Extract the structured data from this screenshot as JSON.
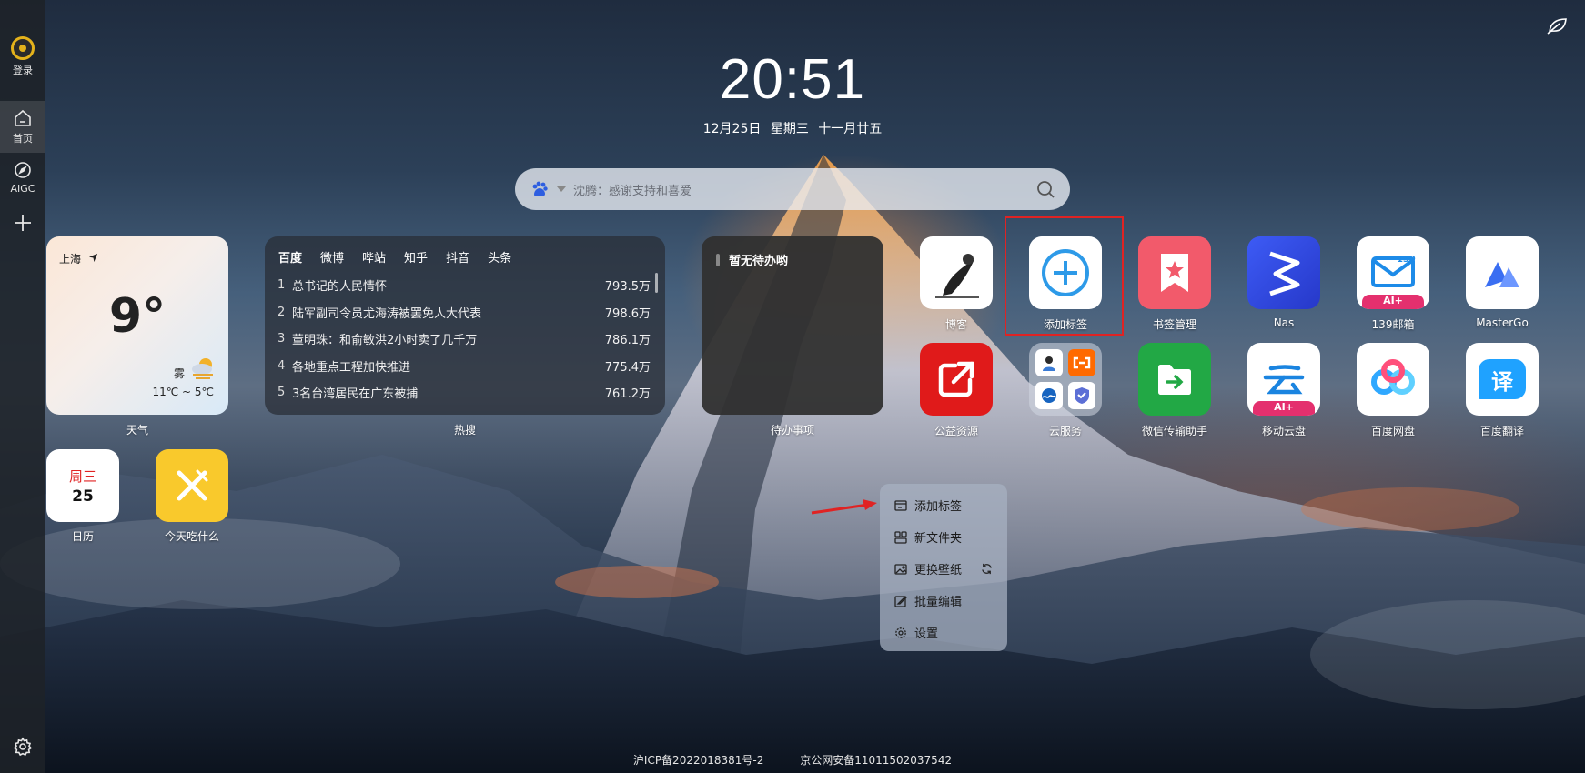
{
  "sidebar": {
    "login_label": "登录",
    "home_label": "首页",
    "aigc_label": "AIGC"
  },
  "clock": {
    "time": "20:51",
    "date": "12月25日  星期三  十一月廿五"
  },
  "search": {
    "placeholder": "沈腾：感谢支持和喜爱"
  },
  "weather": {
    "city": "上海",
    "temp": "9°",
    "condition": "雾",
    "range": "11℃ ~ 5℃",
    "label": "天气"
  },
  "hot": {
    "label": "热搜",
    "tabs": [
      "百度",
      "微博",
      "哔站",
      "知乎",
      "抖音",
      "头条"
    ],
    "rows": [
      {
        "rank": "1",
        "title": "总书记的人民情怀",
        "count": "793.5万"
      },
      {
        "rank": "2",
        "title": "陆军副司令员尤海涛被罢免人大代表",
        "count": "798.6万"
      },
      {
        "rank": "3",
        "title": "董明珠：和俞敏洪2小时卖了几千万",
        "count": "786.1万"
      },
      {
        "rank": "4",
        "title": "各地重点工程加快推进",
        "count": "775.4万"
      },
      {
        "rank": "5",
        "title": "3名台湾居民在广东被捕",
        "count": "761.2万"
      }
    ]
  },
  "todo": {
    "header": "暂无待办哟",
    "label": "待办事项"
  },
  "calendar": {
    "weekday": "周三",
    "day": "25",
    "label": "日历"
  },
  "food": {
    "label": "今天吃什么"
  },
  "apps": [
    {
      "label": "博客"
    },
    {
      "label": "添加标签"
    },
    {
      "label": "书签管理"
    },
    {
      "label": "Nas"
    },
    {
      "label": "139邮箱",
      "badge": "139",
      "ai": "AI+"
    },
    {
      "label": "MasterGo"
    },
    {
      "label": "公益资源"
    },
    {
      "label": "云服务"
    },
    {
      "label": "微信传输助手"
    },
    {
      "label": "移动云盘",
      "ai": "AI+"
    },
    {
      "label": "百度网盘"
    },
    {
      "label": "百度翻译",
      "glyph": "译"
    }
  ],
  "context_menu": {
    "items": [
      "添加标签",
      "新文件夹",
      "更换壁纸",
      "批量编辑",
      "设置"
    ]
  },
  "footer": {
    "icp": "沪ICP备2022018381号-2",
    "police": "京公网安备11011502037542"
  },
  "colors": {
    "accent_red": "#e02323",
    "login_yellow": "#e4b21b"
  }
}
